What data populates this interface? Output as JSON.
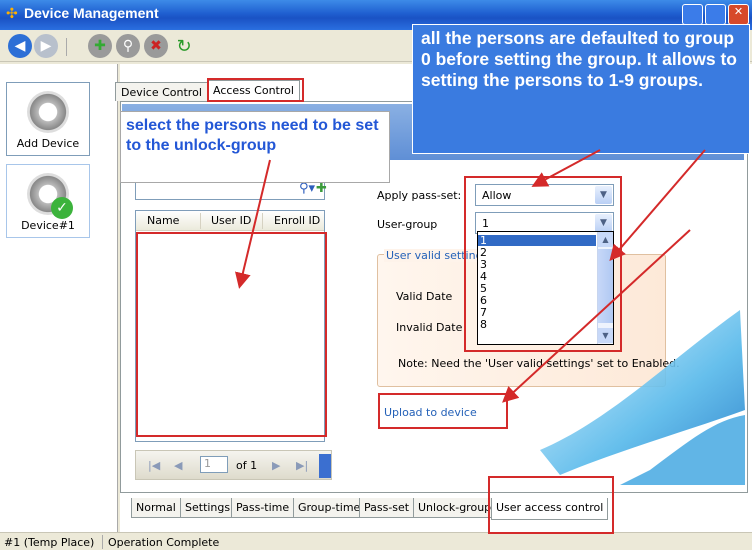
{
  "window": {
    "title": "Device Management"
  },
  "sidebar": {
    "devices": [
      {
        "label": "Add Device"
      },
      {
        "label": "Device#1"
      }
    ]
  },
  "top_tabs": [
    {
      "label": "Device Control"
    },
    {
      "label": "Access Control"
    }
  ],
  "header_fragment": "ol",
  "member_list": {
    "columns": [
      "Name",
      "User ID",
      "Enroll ID"
    ],
    "rows": []
  },
  "pager": {
    "first": "|◀",
    "prev": "◀",
    "page_value": "1",
    "page_of": "of 1",
    "next": "▶",
    "last": "▶|"
  },
  "form": {
    "pass_set_label": "Apply pass-set:",
    "pass_set_value": "Allow",
    "user_group_label": "User-group",
    "user_group_value": "1",
    "group_options": [
      "1",
      "2",
      "3",
      "4",
      "5",
      "6",
      "7",
      "8"
    ],
    "user_valid_title": "User valid settings",
    "valid_date_label": "Valid Date",
    "invalid_date_label": "Invalid Date",
    "note": "Note: Need the 'User valid settings' set to Enabled.",
    "upload_link": "Upload to device"
  },
  "bottom_tabs": [
    {
      "label": "Normal"
    },
    {
      "label": "Settings"
    },
    {
      "label": "Pass-time"
    },
    {
      "label": "Group-time"
    },
    {
      "label": "Pass-set"
    },
    {
      "label": "Unlock-group"
    },
    {
      "label": "User access control"
    }
  ],
  "status": {
    "device": "#1 (Temp Place)",
    "message": "Operation Complete"
  },
  "annotations": {
    "left_note": "select the persons need to be set to the unlock-group",
    "right_note": "all the persons are defaulted to group 0 before setting the group. It allows to setting the persons to 1-9 groups."
  },
  "colors": {
    "titlebar": "#1f5fd0",
    "annotation_text": "#2357d6",
    "highlight": "#d42a2a",
    "link": "#2461b8"
  }
}
